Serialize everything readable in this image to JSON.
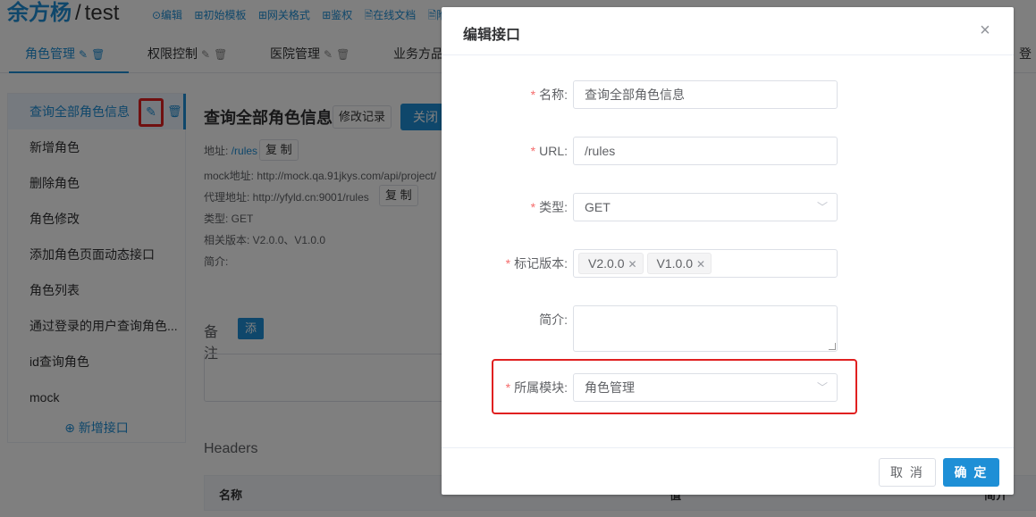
{
  "header": {
    "project_owner": "余方杨",
    "separator": "/",
    "project_name": "test",
    "links": [
      "⊙编辑",
      "⊞初始模板",
      "⊞网关格式",
      "⊞鉴权",
      "🗎在线文档",
      "🗎附"
    ]
  },
  "tabs": [
    {
      "label": "角色管理"
    },
    {
      "label": "权限控制"
    },
    {
      "label": "医院管理"
    },
    {
      "label": "业务方品"
    }
  ],
  "login_label": "登",
  "sidebar": {
    "items": [
      {
        "label": "查询全部角色信息"
      },
      {
        "label": "新增角色"
      },
      {
        "label": "删除角色"
      },
      {
        "label": "角色修改"
      },
      {
        "label": "添加角色页面动态接口"
      },
      {
        "label": "角色列表"
      },
      {
        "label": "通过登录的用户查询角色..."
      },
      {
        "label": "id查询角色"
      },
      {
        "label": "mock"
      }
    ],
    "add_label": "⊕ 新增接口"
  },
  "detail": {
    "title": "查询全部角色信息",
    "modify_log": "修改记录",
    "close_label": "关闭",
    "address_label": "地址:",
    "address_value": "/rules",
    "copy_label": "复 制",
    "mock_label": "mock地址: http://mock.qa.91jkys.com/api/project/",
    "proxy_label": "代理地址: http://yfyld.cn:9001/rules",
    "type_label": "类型:  GET",
    "versions_label": "相关版本:  V2.0.0、V1.0.0",
    "intro_label": "简介:",
    "remark_title": "备注",
    "remark_add": "添 加",
    "headers_title": "Headers",
    "table_cols": [
      "名称",
      "值",
      "简介"
    ]
  },
  "dialog": {
    "title": "编辑接口",
    "close_icon": "×",
    "fields": {
      "name": {
        "label": "名称:",
        "value": "查询全部角色信息"
      },
      "url": {
        "label": "URL:",
        "value": "/rules"
      },
      "type": {
        "label": "类型:",
        "value": "GET"
      },
      "version": {
        "label": "标记版本:",
        "tags": [
          "V2.0.0",
          "V1.0.0"
        ]
      },
      "intro": {
        "label": "简介:",
        "value": ""
      },
      "module": {
        "label": "所属模块:",
        "value": "角色管理"
      }
    },
    "required_mark": "*",
    "cancel_label": "取 消",
    "ok_label": "确 定"
  },
  "colors": {
    "primary": "#1e8fd6",
    "required": "#f56c6c",
    "highlight": "#e02020"
  }
}
